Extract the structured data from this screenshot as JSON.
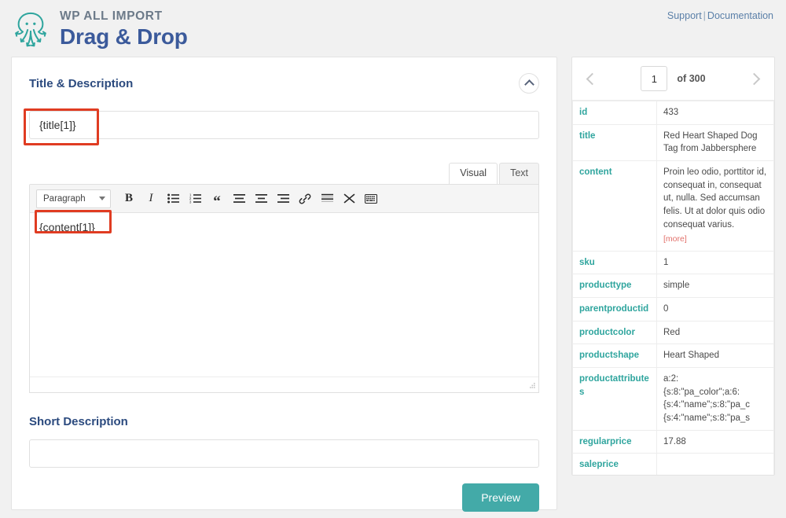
{
  "header": {
    "brand_kicker": "WP ALL IMPORT",
    "brand_title": "Drag & Drop",
    "logo_icon": "octopus-icon",
    "support_label": "Support",
    "separator": "|",
    "documentation_label": "Documentation"
  },
  "main": {
    "section_title": "Title & Description",
    "collapse_icon": "chevron-up-icon",
    "title_field": {
      "value": "{title[1]}",
      "placeholder": ""
    },
    "editor": {
      "tabs": [
        {
          "label": "Visual",
          "active": true
        },
        {
          "label": "Text",
          "active": false
        }
      ],
      "format_select": {
        "value": "Paragraph",
        "caret_icon": "chevron-down-icon"
      },
      "toolbar_buttons": [
        {
          "name": "bold-button",
          "glyph": "B",
          "title": "Bold"
        },
        {
          "name": "italic-button",
          "glyph": "I",
          "title": "Italic"
        },
        {
          "name": "bulleted-list-button",
          "glyph": "",
          "title": "Bulleted list"
        },
        {
          "name": "numbered-list-button",
          "glyph": "",
          "title": "Numbered list"
        },
        {
          "name": "blockquote-button",
          "glyph": "“",
          "title": "Blockquote"
        },
        {
          "name": "align-left-button",
          "glyph": "",
          "title": "Align left"
        },
        {
          "name": "align-center-button",
          "glyph": "",
          "title": "Align center"
        },
        {
          "name": "align-right-button",
          "glyph": "",
          "title": "Align right"
        },
        {
          "name": "insert-link-button",
          "glyph": "",
          "title": "Insert/edit link"
        },
        {
          "name": "read-more-button",
          "glyph": "",
          "title": "Insert Read More tag"
        },
        {
          "name": "toolbar-toggle-button",
          "glyph": "",
          "title": "Toolbar Toggle"
        },
        {
          "name": "keyboard-shortcuts-button",
          "glyph": "",
          "title": "Keyboard shortcuts"
        }
      ],
      "content_value": "{content[1]}"
    },
    "short_description_label": "Short Description",
    "short_description_field": {
      "value": "",
      "placeholder": ""
    },
    "preview_button_label": "Preview"
  },
  "annotations": {
    "highlight_color": "#e03c22",
    "boxes": [
      "title-field-highlight",
      "content-token-highlight"
    ]
  },
  "sidebar": {
    "pager": {
      "prev_icon": "chevron-left-icon",
      "next_icon": "chevron-right-icon",
      "current_page": "1",
      "total_label": "of 300"
    },
    "rows": [
      {
        "key": "id",
        "value": "433"
      },
      {
        "key": "title",
        "value": "Red Heart Shaped Dog Tag from Jabbersphere"
      },
      {
        "key": "content",
        "value": "Proin leo odio, porttitor id, consequat in, consequat ut, nulla. Sed accumsan felis. Ut at dolor quis odio consequat varius.",
        "more_label": "[more]"
      },
      {
        "key": "sku",
        "value": "1"
      },
      {
        "key": "producttype",
        "value": "simple"
      },
      {
        "key": "parentproductid",
        "value": "0"
      },
      {
        "key": "productcolor",
        "value": "Red"
      },
      {
        "key": "productshape",
        "value": "Heart Shaped"
      },
      {
        "key": "productattributes",
        "value_lines": [
          "a:2:",
          "{s:8:\"pa_color\";a:6:",
          "{s:4:\"name\";s:8:\"pa_c",
          "{s:4:\"name\";s:8:\"pa_s"
        ]
      },
      {
        "key": "regularprice",
        "value": "17.88"
      },
      {
        "key": "saleprice",
        "value": ""
      }
    ]
  },
  "colors": {
    "brand_blue": "#3b5a9b",
    "teal": "#2fa59e",
    "preview_button": "#43aaa8",
    "highlight_red": "#e03c22",
    "more_red": "#e2716b",
    "link_blue": "#5a7fa8"
  }
}
